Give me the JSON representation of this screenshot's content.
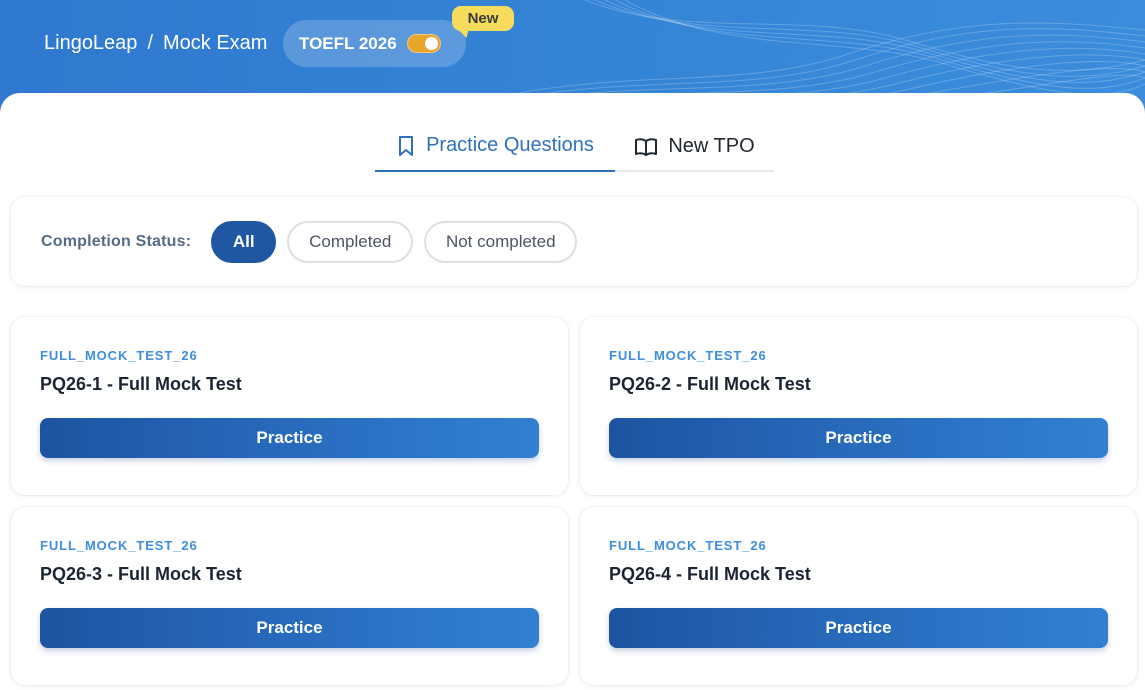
{
  "header": {
    "breadcrumb": [
      "LingoLeap",
      "Mock Exam"
    ],
    "breadcrumb_separator": "/",
    "toggle_label": "TOEFL 2026",
    "toggle_on": true,
    "badge": "New"
  },
  "tabs": [
    {
      "label": "Practice Questions",
      "icon": "bookmark-icon",
      "active": true
    },
    {
      "label": "New TPO",
      "icon": "open-book-icon",
      "active": false
    }
  ],
  "filter": {
    "label": "Completion Status:",
    "options": [
      {
        "label": "All",
        "selected": true
      },
      {
        "label": "Completed",
        "selected": false
      },
      {
        "label": "Not completed",
        "selected": false
      }
    ]
  },
  "cards": [
    {
      "tag": "FULL_MOCK_TEST_26",
      "title": "PQ26-1 - Full Mock Test",
      "button": "Practice"
    },
    {
      "tag": "FULL_MOCK_TEST_26",
      "title": "PQ26-2 - Full Mock Test",
      "button": "Practice"
    },
    {
      "tag": "FULL_MOCK_TEST_26",
      "title": "PQ26-3 - Full Mock Test",
      "button": "Practice"
    },
    {
      "tag": "FULL_MOCK_TEST_26",
      "title": "PQ26-4 - Full Mock Test",
      "button": "Practice"
    }
  ],
  "colors": {
    "header_blue": "#3282d4",
    "accent": "#1f57a3",
    "tag_blue": "#3d8de0",
    "switch_on": "#e8a52c",
    "badge_yellow": "#f6dc5c"
  }
}
